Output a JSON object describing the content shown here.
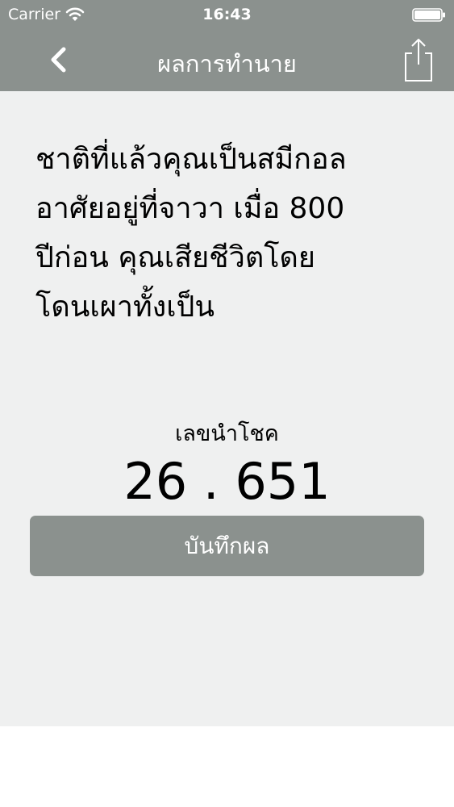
{
  "status_bar": {
    "carrier": "Carrier",
    "time": "16:43",
    "wifi_icon": "wifi-icon",
    "battery_icon": "battery-icon"
  },
  "nav": {
    "title": "ผลการทำนาย",
    "back_icon": "chevron-left-icon",
    "share_icon": "share-icon"
  },
  "result": {
    "lines": [
      "ชาติที่แล้วคุณเป็นสมีกอล",
      "อาศัยอยู่ที่จาวา เมื่อ 800",
      "ปีก่อน คุณเสียชีวิตโดย",
      "โดนเผาทั้งเป็น"
    ],
    "lucky_label": "เลขนำโชค",
    "lucky_number": "26 . 651"
  },
  "actions": {
    "save_label": "บันทึกผล"
  },
  "colors": {
    "header_bg": "#8b918e",
    "content_bg": "#eff0f0",
    "button_bg": "#8b918e",
    "text": "#000000",
    "header_text": "#ffffff"
  }
}
